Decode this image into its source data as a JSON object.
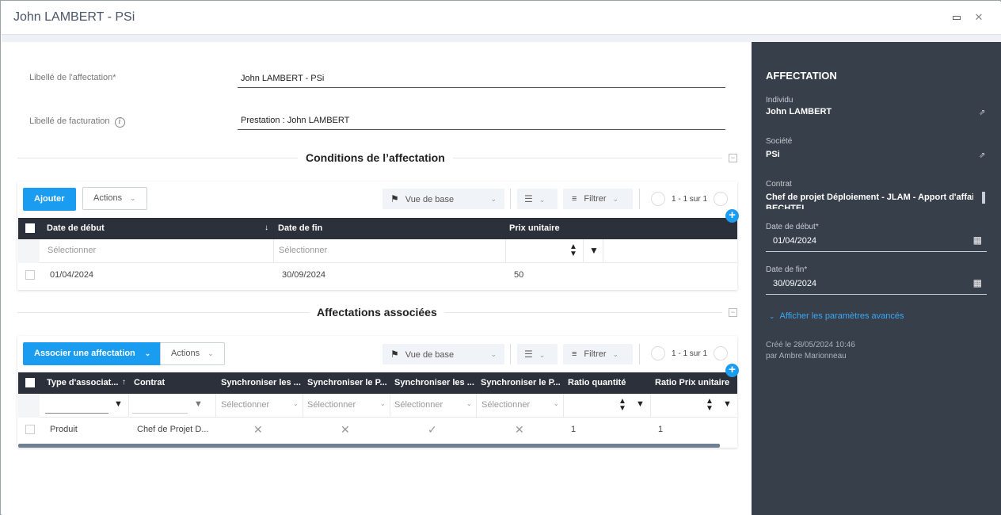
{
  "window": {
    "title": "John LAMBERT - PSi"
  },
  "form": {
    "label1": "Libellé de l'affectation*",
    "value1": "John LAMBERT - PSi",
    "label2": "Libellé de facturation",
    "value2": "Prestation : John LAMBERT",
    "info_glyph": "i"
  },
  "section1": {
    "title": "Conditions de l’affectation",
    "add_label": "Ajouter",
    "actions_label": "Actions",
    "view_label": "Vue de base",
    "filter_label": "Filtrer",
    "pager": "1 - 1 sur 1",
    "columns": [
      "Date de début",
      "Date de fin",
      "Prix unitaire"
    ],
    "sort_glyph": "↓",
    "placeholders": [
      "Sélectionner",
      "Sélectionner"
    ],
    "row": [
      "01/04/2024",
      "30/09/2024",
      "50"
    ]
  },
  "section2": {
    "title": "Affectations associées",
    "add_label": "Associer une affectation",
    "actions_label": "Actions",
    "view_label": "Vue de base",
    "filter_label": "Filtrer",
    "pager": "1 - 1 sur 1",
    "columns": [
      "Type d'associat...",
      "Contrat",
      "Synchroniser les ...",
      "Synchroniser le P...",
      "Synchroniser les ...",
      "Synchroniser le P...",
      "Ratio quantité",
      "Ratio Prix unitaire"
    ],
    "sort_glyph": "↑",
    "placeholder": "Sélectionner",
    "row": {
      "type": "Produit",
      "contrat": "Chef de Projet D...",
      "sync1": "✕",
      "sync2": "✕",
      "sync3": "✓",
      "sync4": "✕",
      "ratio_q": "1",
      "ratio_p": "1"
    }
  },
  "side": {
    "heading": "AFFECTATION",
    "individu_label": "Individu",
    "individu_value": "John LAMBERT",
    "societe_label": "Société",
    "societe_value": "PSi",
    "contrat_label": "Contrat",
    "contrat_value": "Chef de projet Déploiement - JLAM - Apport d'affaire",
    "contrat_value_cut": "BECHTEL",
    "debut_label": "Date de début*",
    "debut_value": "01/04/2024",
    "fin_label": "Date de fin*",
    "fin_value": "30/09/2024",
    "advanced_link": "Afficher les paramètres avancés",
    "created_line": "Créé le  28/05/2024 10:46",
    "created_by": "par Ambre Marionneau"
  },
  "colors": {
    "accent": "#1a9cf0",
    "sidebar": "#373f4a",
    "table_header": "#2b303b"
  }
}
